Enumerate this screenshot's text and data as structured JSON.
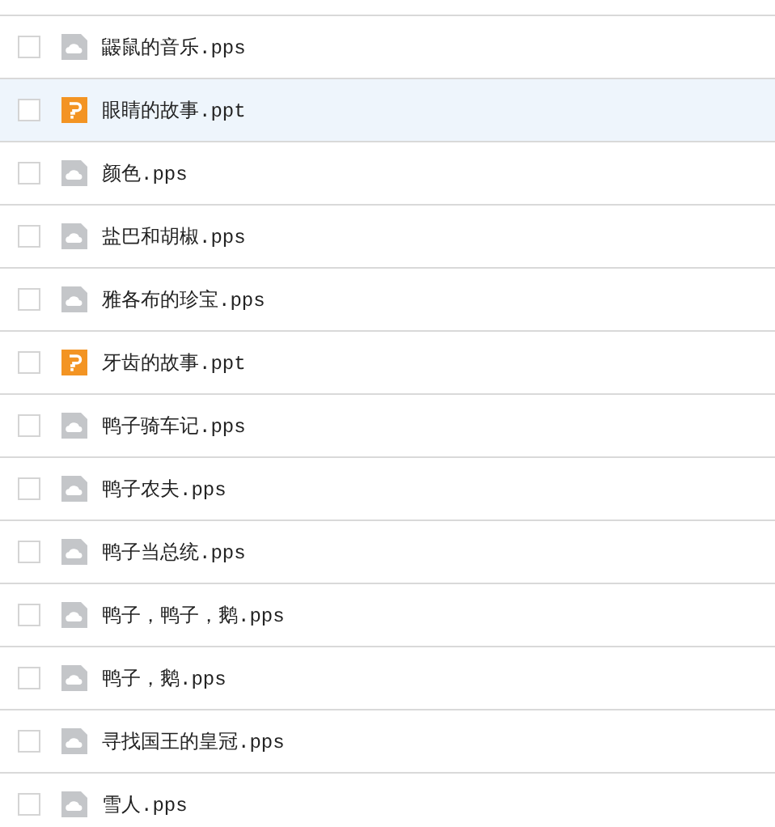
{
  "files": [
    {
      "name": "鼹鼠的音乐.pps",
      "kind": "pps",
      "checked": false,
      "highlighted": false
    },
    {
      "name": "眼睛的故事.ppt",
      "kind": "ppt",
      "checked": false,
      "highlighted": true
    },
    {
      "name": "颜色.pps",
      "kind": "pps",
      "checked": false,
      "highlighted": false
    },
    {
      "name": "盐巴和胡椒.pps",
      "kind": "pps",
      "checked": false,
      "highlighted": false
    },
    {
      "name": "雅各布的珍宝.pps",
      "kind": "pps",
      "checked": false,
      "highlighted": false
    },
    {
      "name": "牙齿的故事.ppt",
      "kind": "ppt",
      "checked": false,
      "highlighted": false
    },
    {
      "name": "鸭子骑车记.pps",
      "kind": "pps",
      "checked": false,
      "highlighted": false
    },
    {
      "name": "鸭子农夫.pps",
      "kind": "pps",
      "checked": false,
      "highlighted": false
    },
    {
      "name": "鸭子当总统.pps",
      "kind": "pps",
      "checked": false,
      "highlighted": false
    },
    {
      "name": "鸭子，鸭子，鹅.pps",
      "kind": "pps",
      "checked": false,
      "highlighted": false
    },
    {
      "name": "鸭子，鹅.pps",
      "kind": "pps",
      "checked": false,
      "highlighted": false
    },
    {
      "name": "寻找国王的皇冠.pps",
      "kind": "pps",
      "checked": false,
      "highlighted": false
    },
    {
      "name": "雪人.pps",
      "kind": "pps",
      "checked": false,
      "highlighted": false
    }
  ]
}
